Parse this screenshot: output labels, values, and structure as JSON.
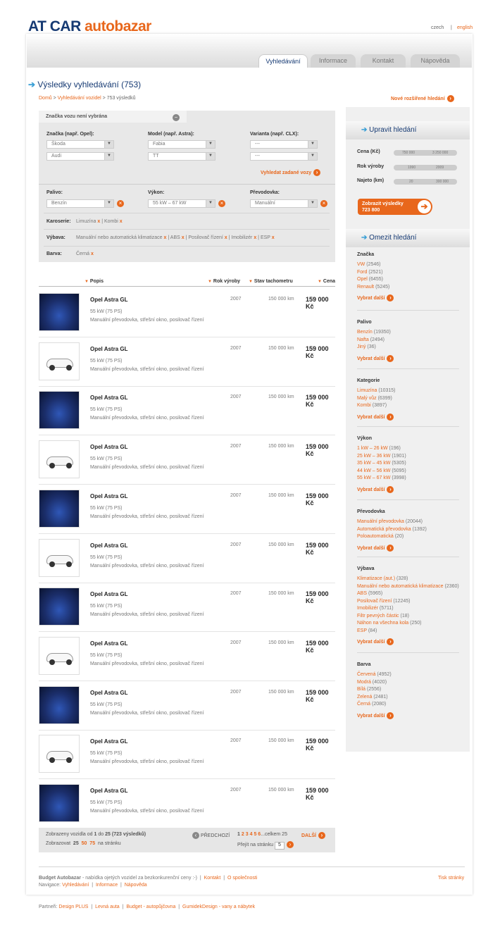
{
  "logo": {
    "part1": "AT CAR",
    "part2": "autobazar"
  },
  "lang": {
    "czech": "czech",
    "sep": "|",
    "english": "english"
  },
  "tabs": [
    "Vyhledávání",
    "Informace",
    "Kontakt",
    "Nápověda"
  ],
  "title": "Výsledky vyhledávání (753)",
  "breadcrumb": {
    "home": "Domů",
    "sep": " > ",
    "search": "Vyhledávání vozidel",
    "current": "753 výsledků"
  },
  "new_search": "Nové rozšířené hledání",
  "filter": {
    "header": "Značka vozu není vybrána",
    "brand_label": "Značka (např. Opel):",
    "model_label": "Model (např. Astra):",
    "variant_label": "Varianta (např. CLX):",
    "brand1": "Škoda",
    "brand2": "Audi",
    "model1": "Fabia",
    "model2": "TT",
    "variant1": "---",
    "variant2": "---",
    "search_btn": "Vyhledat zadané vozy",
    "fuel_label": "Palivo:",
    "fuel_value": "Benzín",
    "power_label": "Výkon:",
    "power_value": "55 kW – 67 kW",
    "gear_label": "Převodovka:",
    "gear_value": "Manuální",
    "body_label": "Karoserie:",
    "body_items": [
      "Limuzína",
      "Kombi"
    ],
    "equip_label": "Výbava:",
    "equip_items": [
      "Manuální nebo automatická klimatizace",
      "ABS",
      "Posilovač řízení",
      "Imobilizér",
      "ESP"
    ],
    "color_label": "Barva:",
    "color_items": [
      "Černá"
    ],
    "remove": "x",
    "pipe": "|"
  },
  "columns": {
    "desc": "Popis",
    "year": "Rok výroby",
    "km": "Stav tachometru",
    "price": "Cena"
  },
  "results": [
    {
      "name": "Opel Astra GL",
      "power": "55 kW (75 PS)",
      "desc": "Manuální převodovka, střešní okno, posilovač řízení",
      "year": "2007",
      "km": "150 000 km",
      "price": "159 000 Kč",
      "thumb": "blue-car-photo"
    },
    {
      "name": "Opel Astra GL",
      "power": "55 kW (75 PS)",
      "desc": "Manuální převodovka, střešní okno, posilovač řízení",
      "year": "2007",
      "km": "150 000 km",
      "price": "159 000 Kč",
      "thumb": "white-car-photo"
    },
    {
      "name": "Opel Astra GL",
      "power": "55 kW (75 PS)",
      "desc": "Manuální převodovka, střešní okno, posilovač řízení",
      "year": "2007",
      "km": "150 000 km",
      "price": "159 000 Kč",
      "thumb": "blue-car-photo"
    },
    {
      "name": "Opel Astra GL",
      "power": "55 kW (75 PS)",
      "desc": "Manuální převodovka, střešní okno, posilovač řízení",
      "year": "2007",
      "km": "150 000 km",
      "price": "159 000 Kč",
      "thumb": "white-car-photo"
    },
    {
      "name": "Opel Astra GL",
      "power": "55 kW (75 PS)",
      "desc": "Manuální převodovka, střešní okno, posilovač řízení",
      "year": "2007",
      "km": "150 000 km",
      "price": "159 000 Kč",
      "thumb": "blue-car-photo"
    },
    {
      "name": "Opel Astra GL",
      "power": "55 kW (75 PS)",
      "desc": "Manuální převodovka, střešní okno, posilovač řízení",
      "year": "2007",
      "km": "150 000 km",
      "price": "159 000 Kč",
      "thumb": "white-car-photo"
    },
    {
      "name": "Opel Astra GL",
      "power": "55 kW (75 PS)",
      "desc": "Manuální převodovka, střešní okno, posilovač řízení",
      "year": "2007",
      "km": "150 000 km",
      "price": "159 000 Kč",
      "thumb": "blue-car-photo"
    },
    {
      "name": "Opel Astra GL",
      "power": "55 kW (75 PS)",
      "desc": "Manuální převodovka, střešní okno, posilovač řízení",
      "year": "2007",
      "km": "150 000 km",
      "price": "159 000 Kč",
      "thumb": "white-car-photo"
    },
    {
      "name": "Opel Astra GL",
      "power": "55 kW (75 PS)",
      "desc": "Manuální převodovka, střešní okno, posilovač řízení",
      "year": "2007",
      "km": "150 000 km",
      "price": "159 000 Kč",
      "thumb": "blue-car-photo"
    },
    {
      "name": "Opel Astra GL",
      "power": "55 kW (75 PS)",
      "desc": "Manuální převodovka, střešní okno, posilovač řízení",
      "year": "2007",
      "km": "150 000 km",
      "price": "159 000 Kč",
      "thumb": "white-car-photo"
    },
    {
      "name": "Opel Astra GL",
      "power": "55 kW (75 PS)",
      "desc": "Manuální převodovka, střešní okno, posilovač řízení",
      "year": "2007",
      "km": "150 000 km",
      "price": "159 000 Kč",
      "thumb": "blue-car-photo"
    }
  ],
  "pager": {
    "shown_prefix": "Zobrazeny vozidla od",
    "from": "1",
    "to_word": "do",
    "to": "25",
    "total": "(723 výsledků)",
    "show_label": "Zobrazovat",
    "sizes": [
      "25",
      "50",
      "75"
    ],
    "per_page": "na stránku",
    "prev": "PŘEDCHOZÍ",
    "pages": [
      "1",
      "2",
      "3",
      "4",
      "5",
      "6"
    ],
    "ellipsis": "...celkem",
    "total_pages": "25",
    "next": "DALŠÍ",
    "goto_label": "Přejít na stránku",
    "goto_value": "5"
  },
  "side": {
    "refine_title": "Upravit hledání",
    "price_label": "Cena (Kč)",
    "price_min": "750 000",
    "price_max": "3 250 000",
    "year_label": "Rok výroby",
    "year_min": "1990",
    "year_max": "2009",
    "km_label": "Najeto (km)",
    "km_min": "20",
    "km_max": "300 000",
    "show_btn": "Zobrazit výsledky",
    "show_count": "723 800",
    "narrow_title": "Omezit hledání",
    "more": "Vybrat další",
    "groups": [
      {
        "title": "Značka",
        "items": [
          [
            "VW",
            "(2546)"
          ],
          [
            "Ford",
            "(2521)"
          ],
          [
            "Opel",
            "(6455)"
          ],
          [
            "Renault",
            "(5245)"
          ]
        ]
      },
      {
        "title": "Palivo",
        "items": [
          [
            "Benzín",
            "(19350)"
          ],
          [
            "Nafta",
            "(2494)"
          ],
          [
            "Jiný",
            "(36)"
          ]
        ]
      },
      {
        "title": "Kategorie",
        "items": [
          [
            "Limuzína",
            "(10315)"
          ],
          [
            "Malý vůz",
            "(6399)"
          ],
          [
            "Kombi",
            "(3897)"
          ]
        ]
      },
      {
        "title": "Výkon",
        "items": [
          [
            "1 kW – 26 kW",
            "(196)"
          ],
          [
            "25 kW – 36 kW",
            "(1901)"
          ],
          [
            "35 kW – 45 kW",
            "(5305)"
          ],
          [
            "44 kW – 56 kW",
            "(5095)"
          ],
          [
            "55 kW – 67 kW",
            "(3998)"
          ]
        ]
      },
      {
        "title": "Převodovka",
        "items": [
          [
            "Manuální převodovka",
            "(20044)"
          ],
          [
            "Automatická převodovka",
            "(1392)"
          ],
          [
            "Poloautomatická",
            "(20)"
          ]
        ]
      },
      {
        "title": "Výbava",
        "items": [
          [
            "Klimatizace (aut.)",
            "(328)"
          ],
          [
            "Manuální nebo automatická klimatizace",
            "(2360)"
          ],
          [
            "ABS",
            "(5965)"
          ],
          [
            "Posilovač řízení",
            "(12245)"
          ],
          [
            "Imobilizér",
            "(5711)"
          ],
          [
            "Filtr pevných částic",
            "(18)"
          ],
          [
            "Náhon na všechna kola",
            "(250)"
          ],
          [
            "ESP",
            "(84)"
          ]
        ]
      },
      {
        "title": "Barva",
        "items": [
          [
            "Červená",
            "(4952)"
          ],
          [
            "Modrá",
            "(4020)"
          ],
          [
            "Bílá",
            "(2556)"
          ],
          [
            "Zelená",
            "(2481)"
          ],
          [
            "Černá",
            "(2080)"
          ]
        ]
      }
    ]
  },
  "footer": {
    "brand": "Budget Autobazar",
    "tagline": " - nabídka ojetých vozidel za bezkonkurenční ceny :-)",
    "contact": "Kontakt",
    "about": "O společnosti",
    "print": "Tisk stránky",
    "nav_label": "Navigace:",
    "nav": [
      "Vyhledávání",
      "Informace",
      "Nápověda"
    ],
    "partners_label": "Partneři:",
    "partners": [
      "Design PLUS",
      "Levná auta",
      "Budget - autopůjčovna",
      "GumidekDesign - vany a nábytek"
    ]
  },
  "colors": {
    "orange": "#e8671c",
    "navy": "#163a73",
    "blue": "#3ba0d6"
  }
}
